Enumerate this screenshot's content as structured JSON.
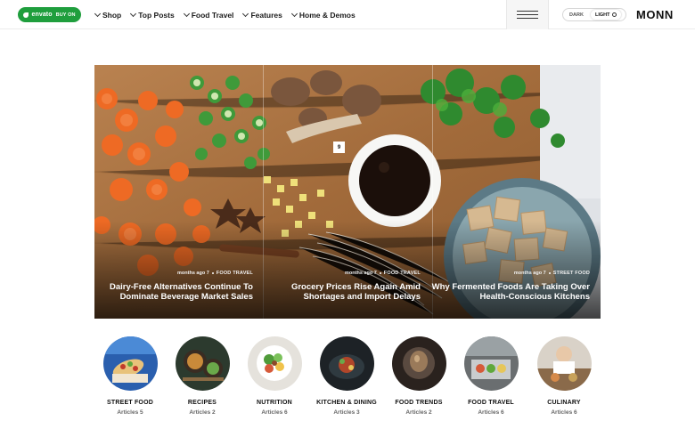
{
  "header": {
    "envato_label": "envato",
    "envato_buy": "BUY ON",
    "nav": [
      {
        "label": "Shop"
      },
      {
        "label": "Top Posts"
      },
      {
        "label": "Food Travel"
      },
      {
        "label": "Features"
      },
      {
        "label": "Home & Demos"
      }
    ],
    "mode_dark": "DARK",
    "mode_light": "LIGHT",
    "logo": "MONN",
    "accent": "#1f9e3d"
  },
  "hero": {
    "badge": "9",
    "slides": [
      {
        "time": "months ago 7",
        "category": "FOOD TRAVEL",
        "title": "Dairy-Free Alternatives Continue To Dominate Beverage Market Sales"
      },
      {
        "time": "months ago 7",
        "category": "FOOD TRAVEL",
        "title": "Grocery Prices Rise Again Amid Shortages and Import Delays"
      },
      {
        "time": "months ago 7",
        "category": "STREET FOOD",
        "title": "Why Fermented Foods Are Taking Over Health-Conscious Kitchens"
      }
    ]
  },
  "categories": [
    {
      "name": "STREET FOOD",
      "count": "Articles 5"
    },
    {
      "name": "RECIPES",
      "count": "Articles 2"
    },
    {
      "name": "NUTRITION",
      "count": "Articles 6"
    },
    {
      "name": "KITCHEN & DINING",
      "count": "Articles 3"
    },
    {
      "name": "FOOD TRENDS",
      "count": "Articles 2"
    },
    {
      "name": "FOOD TRAVEL",
      "count": "Articles 6"
    },
    {
      "name": "CULINARY",
      "count": "Articles 6"
    }
  ]
}
